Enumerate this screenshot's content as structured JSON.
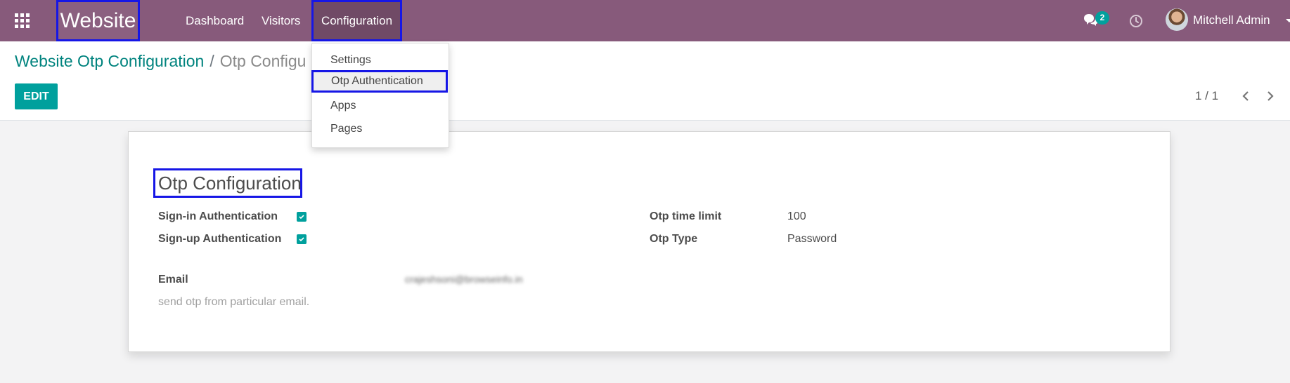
{
  "navbar": {
    "brand": "Website",
    "menu": [
      "Dashboard",
      "Visitors",
      "Configuration"
    ],
    "chat_count": "2",
    "user_name": "Mitchell Admin",
    "color": "#875a7b"
  },
  "breadcrumb": {
    "parent": "Website Otp Configuration",
    "separator": "/",
    "current": "Otp Configu"
  },
  "toolbar": {
    "edit_label": "EDIT",
    "pager": "1 / 1"
  },
  "dropdown": {
    "items": [
      "Settings",
      "Otp Authentication",
      "Apps",
      "Pages"
    ],
    "active_item": "Otp Authentication"
  },
  "form": {
    "title": "Otp Configuration",
    "signin_label": "Sign-in Authentication",
    "signin_checked": true,
    "signup_label": "Sign-up Authentication",
    "signup_checked": true,
    "time_limit_label": "Otp time limit",
    "time_limit_value": "100",
    "otp_type_label": "Otp Type",
    "otp_type_value": "Password",
    "email_label": "Email",
    "email_value": "crajeshsoni@browseinfo.in",
    "email_help": "send otp from particular email."
  },
  "colors": {
    "accent": "#00a09d",
    "highlight_box": "#1616e6"
  }
}
